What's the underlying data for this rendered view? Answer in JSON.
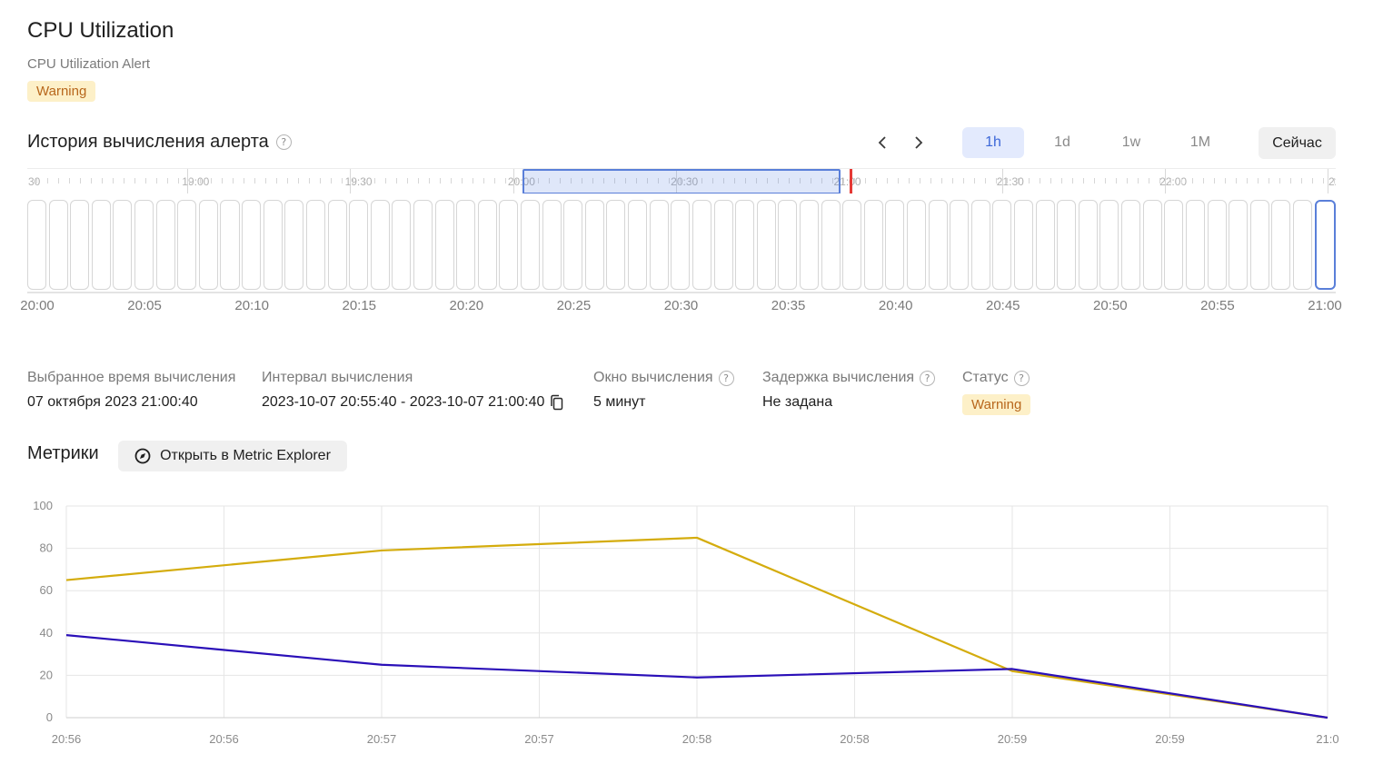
{
  "header": {
    "title": "CPU Utilization",
    "subtitle": "CPU Utilization Alert",
    "status_badge": "Warning"
  },
  "history": {
    "title": "История вычисления алерта",
    "range_options": [
      "1h",
      "1d",
      "1w",
      "1M"
    ],
    "range_active": "1h",
    "now_label": "Сейчас",
    "ruler_labels": [
      ":30",
      "19:00",
      "19:30",
      "20:00",
      "20:30",
      "21:00",
      "21:30",
      "22:00",
      "22:"
    ],
    "cell_count": 61,
    "selected_cell_index": 60,
    "time_axis": [
      "20:00",
      "20:05",
      "20:10",
      "20:15",
      "20:20",
      "20:25",
      "20:30",
      "20:35",
      "20:40",
      "20:45",
      "20:50",
      "20:55",
      "21:00"
    ]
  },
  "details": {
    "selected_time_label": "Выбранное время вычисления",
    "selected_time_value": "07 октября 2023 21:00:40",
    "interval_label": "Интервал вычисления",
    "interval_value": "2023-10-07 20:55:40 - 2023-10-07 21:00:40",
    "window_label": "Окно вычисления",
    "window_value": "5 минут",
    "delay_label": "Задержка вычисления",
    "delay_value": "Не задана",
    "status_label": "Статус",
    "status_value": "Warning"
  },
  "metrics": {
    "title": "Метрики",
    "explorer_button": "Открыть в Metric Explorer"
  },
  "colors": {
    "warning_bg": "#fdf0c8",
    "warning_text": "#b8671c",
    "accent": "#3d68d8",
    "series_1": "#d4ac0d",
    "series_2": "#2a0fb8"
  },
  "chart_data": {
    "type": "line",
    "x_tick_labels": [
      "20:56",
      "20:56",
      "20:57",
      "20:57",
      "20:58",
      "20:58",
      "20:59",
      "20:59",
      "21:0"
    ],
    "ylim": [
      0,
      100
    ],
    "y_ticks": [
      0,
      20,
      40,
      60,
      80,
      100
    ],
    "grid": true,
    "series": [
      {
        "color": "#d4ac0d",
        "x": [
          0,
          2,
          4,
          6,
          8
        ],
        "values": [
          65,
          79,
          85,
          22,
          0
        ]
      },
      {
        "color": "#2a0fb8",
        "x": [
          0,
          2,
          4,
          6,
          8
        ],
        "values": [
          39,
          25,
          19,
          23,
          0
        ]
      }
    ]
  }
}
